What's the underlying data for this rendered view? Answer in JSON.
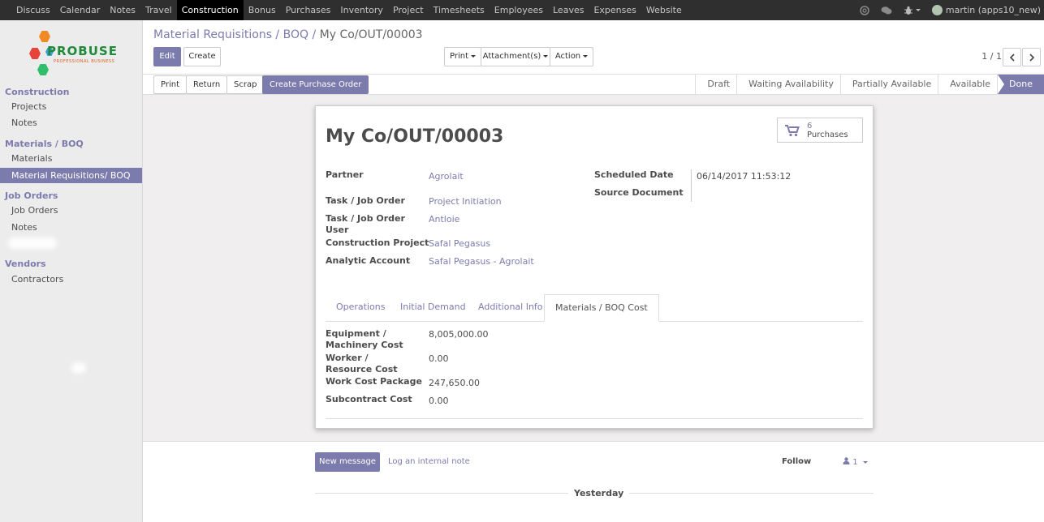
{
  "topbar": {
    "menu": [
      "Discuss",
      "Calendar",
      "Notes",
      "Travel",
      "Construction",
      "Bonus",
      "Purchases",
      "Inventory",
      "Project",
      "Timesheets",
      "Employees",
      "Leaves",
      "Expenses",
      "Website"
    ],
    "active_menu": "Construction",
    "user": "martin (apps10_new)"
  },
  "logo": {
    "brand": "PROBUSE",
    "tagline": "PROFESSIONAL BUSINESS"
  },
  "sidebar": {
    "sections": [
      {
        "title": "Construction",
        "items": [
          "Projects",
          "Notes"
        ]
      },
      {
        "title": "Materials / BOQ",
        "items": [
          "Materials",
          "Material Requisitions/ BOQ"
        ]
      },
      {
        "title": "Job Orders",
        "items": [
          "Job Orders",
          "Notes"
        ]
      },
      {
        "title": "Vendors",
        "items": [
          "Contractors"
        ]
      }
    ],
    "active_item": "Material Requisitions/ BOQ"
  },
  "breadcrumb": {
    "parent": "Material Requisitions / BOQ",
    "separator": "/",
    "current": "My Co/OUT/00003"
  },
  "buttons": {
    "edit": "Edit",
    "create": "Create",
    "print_menu": "Print",
    "attachments_menu": "Attachment(s)",
    "action_menu": "Action"
  },
  "pager": {
    "text": "1 / 1"
  },
  "actions": {
    "print": "Print",
    "return": "Return",
    "scrap": "Scrap",
    "create_po": "Create Purchase Order"
  },
  "stages": [
    "Draft",
    "Waiting Availability",
    "Partially Available",
    "Available",
    "Done"
  ],
  "current_stage": "Done",
  "form": {
    "title": "My Co/OUT/00003",
    "smart_button": {
      "count": "6",
      "label": "Purchases"
    },
    "left_fields": [
      {
        "label": "Partner",
        "value": "Agrolait"
      },
      {
        "label": "Task / Job Order",
        "value": "Project Initiation"
      },
      {
        "label": "Task / Job Order User",
        "value": "Antloie"
      },
      {
        "label": "Construction Project",
        "value": "Safal Pegasus"
      },
      {
        "label": "Analytic Account",
        "value": "Safal Pegasus - Agrolait"
      }
    ],
    "right_fields": [
      {
        "label": "Scheduled Date",
        "value": "06/14/2017 11:53:12"
      },
      {
        "label": "Source Document",
        "value": ""
      }
    ],
    "tabs": [
      "Operations",
      "Initial Demand",
      "Additional Info",
      "Materials / BOQ Cost"
    ],
    "active_tab": "Materials / BOQ Cost",
    "costs": [
      {
        "label": "Equipment / Machinery Cost",
        "value": "8,005,000.00"
      },
      {
        "label": "Worker / Resource Cost",
        "value": "0.00"
      },
      {
        "label": "Work Cost Package",
        "value": "247,650.00"
      },
      {
        "label": "Subcontract Cost",
        "value": "0.00"
      }
    ]
  },
  "chatter": {
    "new_message": "New message",
    "log_note": "Log an internal note",
    "follow": "Follow",
    "followers": "1",
    "day": "Yesterday"
  },
  "colors": {
    "primary": "#7c7bad",
    "topbar": "#2f2f2f",
    "background": "#f0eeee"
  }
}
